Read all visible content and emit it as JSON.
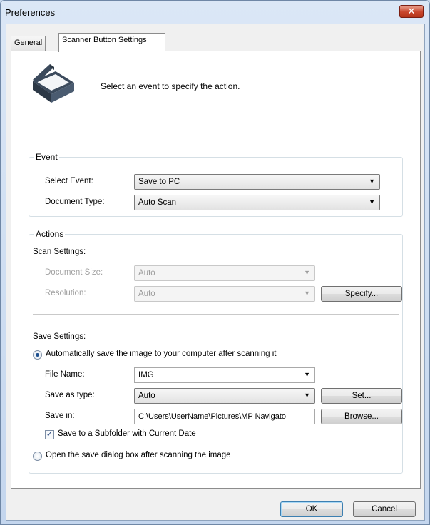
{
  "window": {
    "title": "Preferences",
    "close_glyph": "✕"
  },
  "tabs": [
    {
      "label": "General",
      "active": false
    },
    {
      "label": "Scanner Button Settings",
      "active": true
    }
  ],
  "intro_text": "Select an event to specify the action.",
  "event": {
    "legend": "Event",
    "select_event_label": "Select Event:",
    "select_event_value": "Save to PC",
    "document_type_label": "Document Type:",
    "document_type_value": "Auto Scan"
  },
  "actions": {
    "legend": "Actions",
    "scan_settings_label": "Scan Settings:",
    "document_size_label": "Document Size:",
    "document_size_value": "Auto",
    "resolution_label": "Resolution:",
    "resolution_value": "Auto",
    "specify_label": "Specify...",
    "save_settings_label": "Save Settings:",
    "auto_save_label": "Automatically save the image to your computer after scanning it",
    "file_name_label": "File Name:",
    "file_name_value": "IMG",
    "save_as_type_label": "Save as type:",
    "save_as_type_value": "Auto",
    "set_label": "Set...",
    "save_in_label": "Save in:",
    "save_in_value": "C:\\Users\\UserName\\Pictures\\MP Navigato",
    "browse_label": "Browse...",
    "subfolder_label": "Save to a Subfolder with Current Date",
    "subfolder_checked": true,
    "open_dialog_label": "Open the save dialog box after scanning the image"
  },
  "footer": {
    "ok_label": "OK",
    "cancel_label": "Cancel"
  },
  "icons": {
    "scanner": "scanner-icon",
    "dropdown": "chevron-down-icon"
  },
  "colors": {
    "titlebar": "#dbe7f6",
    "close": "#c9462c",
    "panel": "#ffffff"
  }
}
